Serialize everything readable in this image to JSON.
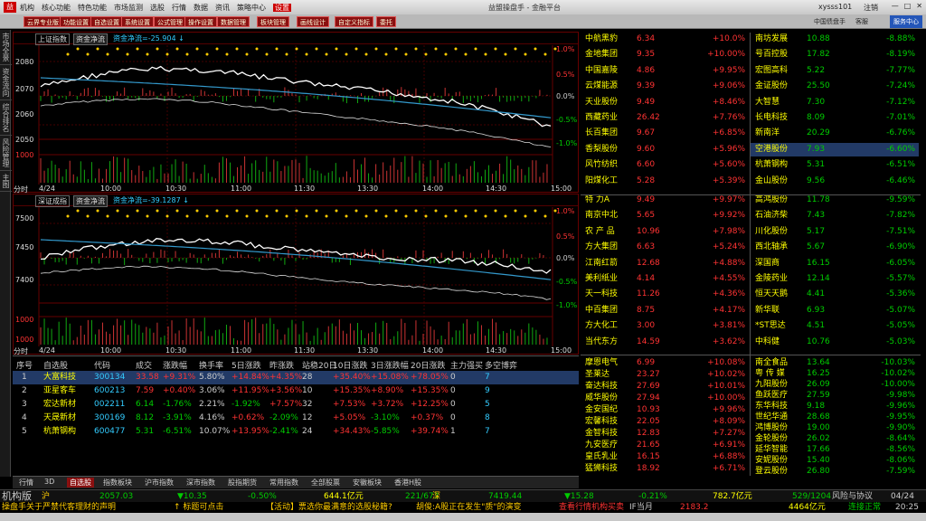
{
  "titlebar": {
    "menu": [
      "机构",
      "核心功能",
      "特色功能",
      "市场监测",
      "选股",
      "行情",
      "数据",
      "资讯",
      "策略中心",
      "设置"
    ],
    "title": "益盟操盘手 - 金融平台",
    "user": "xysss101",
    "login": "注销"
  },
  "toolbar": {
    "buttons": [
      "云界专业版",
      "功能设置",
      "自选设置",
      "系统设置",
      "公式管理",
      "操作设置",
      "数据管理",
      "板块管理",
      "画线设计",
      "自定义指标",
      "委托"
    ],
    "right": [
      "中国债盘手",
      "客服"
    ],
    "settings": "服务中心"
  },
  "leftbar": [
    "市场全景",
    "资金流向",
    "综合排名",
    "风险管理",
    "主图"
  ],
  "chart1": {
    "name": "上证指数",
    "indicator": "资金净流",
    "value": "资金净流=-25.904 ↓",
    "y_left": [
      "2080",
      "2070",
      "2060",
      "2050",
      "1000"
    ],
    "y_right": [
      "1.0%",
      "0.5%",
      "0.0%",
      "-0.5%",
      "-1.0%"
    ],
    "times": [
      "4/24",
      "10:00",
      "10:30",
      "11:00",
      "11:30",
      "13:30",
      "14:00",
      "14:30",
      "15:00"
    ],
    "corner": "分时"
  },
  "chart2": {
    "name": "深证成指",
    "indicator": "资金净流",
    "value": "资金净流=-39.1287 ↓",
    "y_left": [
      "7500",
      "7450",
      "7400",
      "1000",
      "1000"
    ],
    "y_right": [
      "1.0%",
      "0.5%",
      "0.0%",
      "-0.5%",
      "-1.0%"
    ],
    "times": [
      "4/24",
      "10:00",
      "10:30",
      "11:00",
      "11:30",
      "13:30",
      "14:00",
      "14:30",
      "15:00"
    ],
    "corner": "分时"
  },
  "market": {
    "left": [
      [
        "中航黑豹",
        "6.34",
        "+10.0%"
      ],
      [
        "金地集团",
        "9.35",
        "+10.00%"
      ],
      [
        "中国嘉陵",
        "4.86",
        "+9.95%"
      ],
      [
        "云煤能源",
        "9.39",
        "+9.06%"
      ],
      [
        "天业股份",
        "9.49",
        "+8.46%"
      ],
      [
        "西藏药业",
        "26.42",
        "+7.76%"
      ],
      [
        "长百集团",
        "9.67",
        "+6.85%"
      ],
      [
        "香梨股份",
        "9.60",
        "+5.96%"
      ],
      [
        "风竹纺织",
        "6.60",
        "+5.60%"
      ],
      [
        "阳煤化工",
        "5.28",
        "+5.39%"
      ],
      [
        "特  力A",
        "9.49",
        "+9.97%"
      ],
      [
        "南京中北",
        "5.65",
        "+9.92%"
      ],
      [
        "农 产 品",
        "10.96",
        "+7.98%"
      ],
      [
        "方大集团",
        "6.63",
        "+5.24%"
      ],
      [
        "江南红箭",
        "12.68",
        "+4.88%"
      ],
      [
        "美利纸业",
        "4.14",
        "+4.55%"
      ],
      [
        "天一科技",
        "11.26",
        "+4.36%"
      ],
      [
        "中百集团",
        "8.75",
        "+4.17%"
      ],
      [
        "方大化工",
        "3.00",
        "+3.81%"
      ],
      [
        "当代东方",
        "14.59",
        "+3.62%"
      ]
    ],
    "right": [
      [
        "南坊发展",
        "10.88",
        "-8.88%"
      ],
      [
        "号百控股",
        "17.82",
        "-8.19%"
      ],
      [
        "宏图高科",
        "5.22",
        "-7.77%"
      ],
      [
        "金证股份",
        "25.50",
        "-7.24%"
      ],
      [
        "大智慧",
        "7.30",
        "-7.12%"
      ],
      [
        "长电科技",
        "8.09",
        "-7.01%"
      ],
      [
        "新南洋",
        "20.29",
        "-6.76%"
      ],
      [
        "空港股份",
        "7.93",
        "-6.60%"
      ],
      [
        "杭萧钢构",
        "5.31",
        "-6.51%"
      ],
      [
        "金山股份",
        "9.56",
        "-6.46%"
      ],
      [
        "高鸿股份",
        "11.78",
        "-9.59%"
      ],
      [
        "石油济柴",
        "7.43",
        "-7.82%"
      ],
      [
        "川化股份",
        "5.17",
        "-7.51%"
      ],
      [
        "西北轴承",
        "5.67",
        "-6.90%"
      ],
      [
        "深国商",
        "16.15",
        "-6.05%"
      ],
      [
        "金陵药业",
        "12.14",
        "-5.57%"
      ],
      [
        "恒天天鹅",
        "4.41",
        "-5.36%"
      ],
      [
        "新华联",
        "6.93",
        "-5.07%"
      ],
      [
        "*ST思达",
        "4.51",
        "-5.05%"
      ],
      [
        "中科健",
        "10.76",
        "-5.03%"
      ]
    ],
    "lower_left": [
      [
        "摩恩电气",
        "6.99",
        "+10.08%"
      ],
      [
        "圣莱达",
        "23.27",
        "+10.02%"
      ],
      [
        "奋达科技",
        "27.69",
        "+10.01%"
      ],
      [
        "威华股份",
        "27.94",
        "+10.00%"
      ],
      [
        "金安国纪",
        "10.93",
        "+9.96%"
      ],
      [
        "宏馨科技",
        "22.05",
        "+8.09%"
      ],
      [
        "金智科技",
        "12.83",
        "+7.27%"
      ],
      [
        "九安医疗",
        "21.65",
        "+6.91%"
      ],
      [
        "皇氏乳业",
        "16.15",
        "+6.88%"
      ],
      [
        "猛狮科技",
        "18.92",
        "+6.71%"
      ]
    ],
    "lower_right": [
      [
        "南全食品",
        "13.64",
        "-10.03%"
      ],
      [
        "粤 传 媒",
        "16.25",
        "-10.02%"
      ],
      [
        "九阳股份",
        "26.09",
        "-10.00%"
      ],
      [
        "鱼跃医疗",
        "27.59",
        "-9.98%"
      ],
      [
        "东华科技",
        "9.18",
        "-9.96%"
      ],
      [
        "世纪华通",
        "28.68",
        "-9.95%"
      ],
      [
        "鸿博股份",
        "19.00",
        "-9.90%"
      ],
      [
        "金轮股份",
        "26.02",
        "-8.64%"
      ],
      [
        "延华智能",
        "17.66",
        "-8.56%"
      ],
      [
        "安妮股份",
        "15.40",
        "-8.06%"
      ],
      [
        "登云股份",
        "26.80",
        "-7.59%"
      ]
    ],
    "highlight": "空港股份"
  },
  "table": {
    "headers": [
      "序号",
      "自选股",
      "代码",
      "成交",
      "涨跌幅",
      "换手率",
      "5日涨跌",
      "昨涨跌",
      "站稳20日",
      "10日涨跌",
      "3日涨跌幅",
      "20日涨跌",
      "主力强买",
      "多空博弈"
    ],
    "rows": [
      [
        "1",
        "大富科技",
        "300134",
        "33.58",
        "+9.31%",
        "5.80%",
        "+14.84%",
        "+4.35%",
        "28",
        "+35.40%",
        "+15.08%",
        "+78.05%",
        "0",
        "7"
      ],
      [
        "2",
        "亚星客车",
        "600213",
        "7.59",
        "+0.40%",
        "3.06%",
        "+11.95%",
        "+3.56%",
        "10",
        "+15.35%",
        "+8.90%",
        "+15.35%",
        "0",
        "9"
      ],
      [
        "3",
        "宏达新材",
        "002211",
        "6.14",
        "-1.76%",
        "2.21%",
        "-1.92%",
        "+7.57%",
        "32",
        "+7.53%",
        "+3.72%",
        "+12.25%",
        "0",
        "5"
      ],
      [
        "4",
        "天晟新材",
        "300169",
        "8.12",
        "-3.91%",
        "4.16%",
        "+0.62%",
        "-2.09%",
        "12",
        "+5.05%",
        "-3.10%",
        "+0.37%",
        "0",
        "8"
      ],
      [
        "5",
        "杭萧钢构",
        "600477",
        "5.31",
        "-6.51%",
        "10.07%",
        "+13.95%",
        "-2.41%",
        "24",
        "+34.43%",
        "-5.85%",
        "+39.74%",
        "1",
        "7"
      ]
    ]
  },
  "tabs": [
    "行情",
    "3D",
    "自选股",
    "指数板块",
    "沪市指数",
    "深市指数",
    "股指期货",
    "常用指数",
    "全部股票",
    "安徽板块",
    "香港H股"
  ],
  "status1": {
    "brand": "机构版",
    "sh": "沪",
    "sh_val": "2057.03",
    "sh_chg": "▼10.35",
    "sh_pct": "-0.50%",
    "sh_amt": "644.1亿元",
    "sh_ud": "221/673",
    "sz": "深",
    "sz_val": "7419.44",
    "sz_chg": "▼15.28",
    "sz_pct": "-0.21%",
    "sz_amt": "782.7亿元",
    "sz_ud": "529/1204",
    "risk": "风险与协议",
    "date": "04/24"
  },
  "status2": {
    "news1": "操盘手关于严禁代客理财的声明",
    "news2": "↑ 标题可点击",
    "news3": "【活动】票选你最满意的选股秘籍?",
    "news4": "胡俊:A股正在发生\"质\"的演变",
    "f1": "查看行情",
    "f2": "机构买卖",
    "ifl": "IF当月",
    "ifv": "2183.2",
    "t1": "4464亿元",
    "conn": "连接正常",
    "time": "20:25"
  },
  "colors": {
    "up": "#ff3333",
    "down": "#00cc00",
    "accent": "#8a1010",
    "highlight": "#223a66"
  }
}
